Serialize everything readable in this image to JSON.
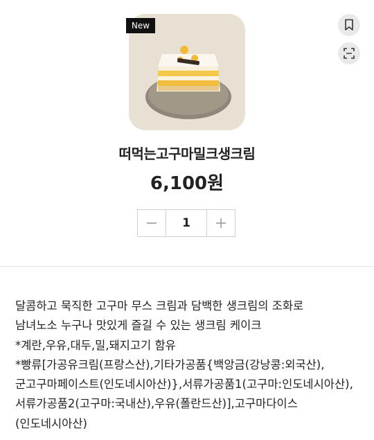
{
  "product": {
    "badge": "New",
    "name": "떠먹는고구마밀크생크림",
    "price": "6,100원",
    "quantity": "1"
  },
  "actions": {
    "bookmark_icon": "bookmark-icon",
    "expand_icon": "fullscreen-icon"
  },
  "description": {
    "lines": [
      "달콤하고 묵직한 고구마 무스 크림과 담백한 생크림의 조화로",
      "남녀노소 누구나 맛있게 즐길 수 있는 생크림 케이크",
      "*계란,우유,대두,밀,돼지고기 함유",
      "*빵류[가공유크림(프랑스산),기타가공품{백앙금(강낭콩:외국산),",
      "군고구마페이스트(인도네시아산)},서류가공품1(고구마:인도네시아산),",
      "서류가공품2(고구마:국내산),우유(폴란드산)],고구마다이스",
      "(인도네시아산)"
    ]
  },
  "colors": {
    "card_bg": "#e8e1d3",
    "badge_bg": "#111111",
    "icon_button_bg": "#e9e9e9"
  }
}
